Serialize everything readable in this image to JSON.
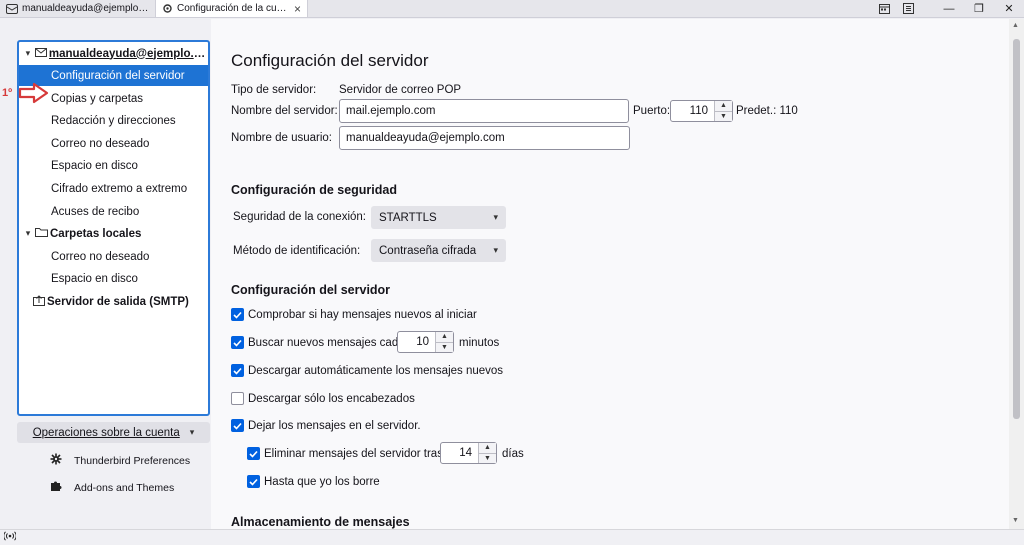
{
  "tabs": [
    {
      "label": "manualdeayuda@ejemplo.com",
      "active": false,
      "icon": "mail-tab-icon"
    },
    {
      "label": "Configuración de la cuenta",
      "active": true,
      "icon": "gear-tab-icon",
      "close": "×"
    }
  ],
  "window_controls": {
    "minimize": "—",
    "maximize": "❐",
    "close": "✕"
  },
  "sidebar": {
    "account": {
      "label": "manualdeayuda@ejemplo.c...",
      "icon": "envelope-icon"
    },
    "account_items": [
      {
        "label": "Configuración del servidor",
        "selected": true
      },
      {
        "label": "Copias y carpetas",
        "selected": false
      },
      {
        "label": "Redacción y direcciones",
        "selected": false
      },
      {
        "label": "Correo no deseado",
        "selected": false
      },
      {
        "label": "Espacio en disco",
        "selected": false
      },
      {
        "label": "Cifrado extremo a extremo",
        "selected": false
      },
      {
        "label": "Acuses de recibo",
        "selected": false
      }
    ],
    "local_folders": {
      "label": "Carpetas locales",
      "icon": "folder-icon"
    },
    "local_items": [
      {
        "label": "Correo no deseado"
      },
      {
        "label": "Espacio en disco"
      }
    ],
    "smtp": {
      "label": "Servidor de salida (SMTP)",
      "icon": "outbox-icon"
    },
    "annotation": "1º",
    "operations_button": "Operaciones sobre la cuenta",
    "links": [
      {
        "label": "Thunderbird Preferences",
        "icon": "gear-icon"
      },
      {
        "label": "Add-ons and Themes",
        "icon": "puzzle-icon"
      }
    ]
  },
  "main": {
    "title": "Configuración del servidor",
    "server_type_label": "Tipo de servidor:",
    "server_type_value": "Servidor de correo POP",
    "server_name_label": "Nombre del servidor:",
    "server_name_value": "mail.ejemplo.com",
    "port_label": "Puerto:",
    "port_value": "110",
    "default_port": "Predet.: 110",
    "username_label": "Nombre de usuario:",
    "username_value": "manualdeayuda@ejemplo.com",
    "security_section": "Configuración de seguridad",
    "connection_security_label": "Seguridad de la conexión:",
    "connection_security_value": "STARTTLS",
    "auth_method_label": "Método de identificación:",
    "auth_method_value": "Contraseña cifrada",
    "server_section": "Configuración del servidor",
    "check_on_startup": {
      "label": "Comprobar si hay mensajes nuevos al iniciar",
      "checked": true
    },
    "check_every": {
      "label": "Buscar nuevos mensajes cada",
      "checked": true,
      "value": "10",
      "unit": "minutos"
    },
    "auto_download": {
      "label": "Descargar automáticamente los mensajes nuevos",
      "checked": true
    },
    "headers_only": {
      "label": "Descargar sólo los encabezados",
      "checked": false
    },
    "leave_on_server": {
      "label": "Dejar los mensajes en el servidor.",
      "checked": true
    },
    "delete_after": {
      "label": "Eliminar mensajes del servidor tras",
      "checked": true,
      "value": "14",
      "unit": "días"
    },
    "until_deleted": {
      "label": "Hasta que yo los borre",
      "checked": true
    },
    "storage_section": "Almacenamiento de mensajes"
  },
  "colors": {
    "accent": "#0061e0",
    "selected_bg": "#1e73d4",
    "tree_border": "#2c7ad8",
    "annotation": "#d63a3a"
  }
}
